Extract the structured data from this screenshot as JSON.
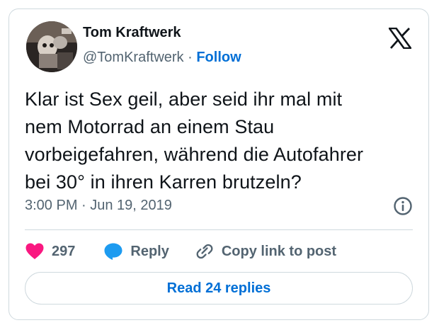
{
  "author": {
    "name": "Tom Kraftwerk",
    "handle": "@TomKraftwerk",
    "separator": "·",
    "follow_label": "Follow",
    "avatar_icon": "profile-photo"
  },
  "platform_icon": "x-logo-icon",
  "tweet": {
    "lines": [
      "Klar ist Sex geil, aber seid ihr mal mit",
      "nem Motorrad an einem Stau",
      "vorbeigefahren, während die Autofahrer",
      "bei 30° in ihren Karren brutzeln?"
    ],
    "timestamp": "3:00 PM · Jun 19, 2019"
  },
  "actions": {
    "like_count": "297",
    "reply_label": "Reply",
    "copy_label": "Copy link to post"
  },
  "read_replies_label": "Read 24 replies",
  "colors": {
    "accent": "#006fd6",
    "like": "#f91880",
    "reply": "#1d9bf0",
    "text": "#0f1419",
    "muted": "#536471",
    "border": "#cfd9de"
  }
}
